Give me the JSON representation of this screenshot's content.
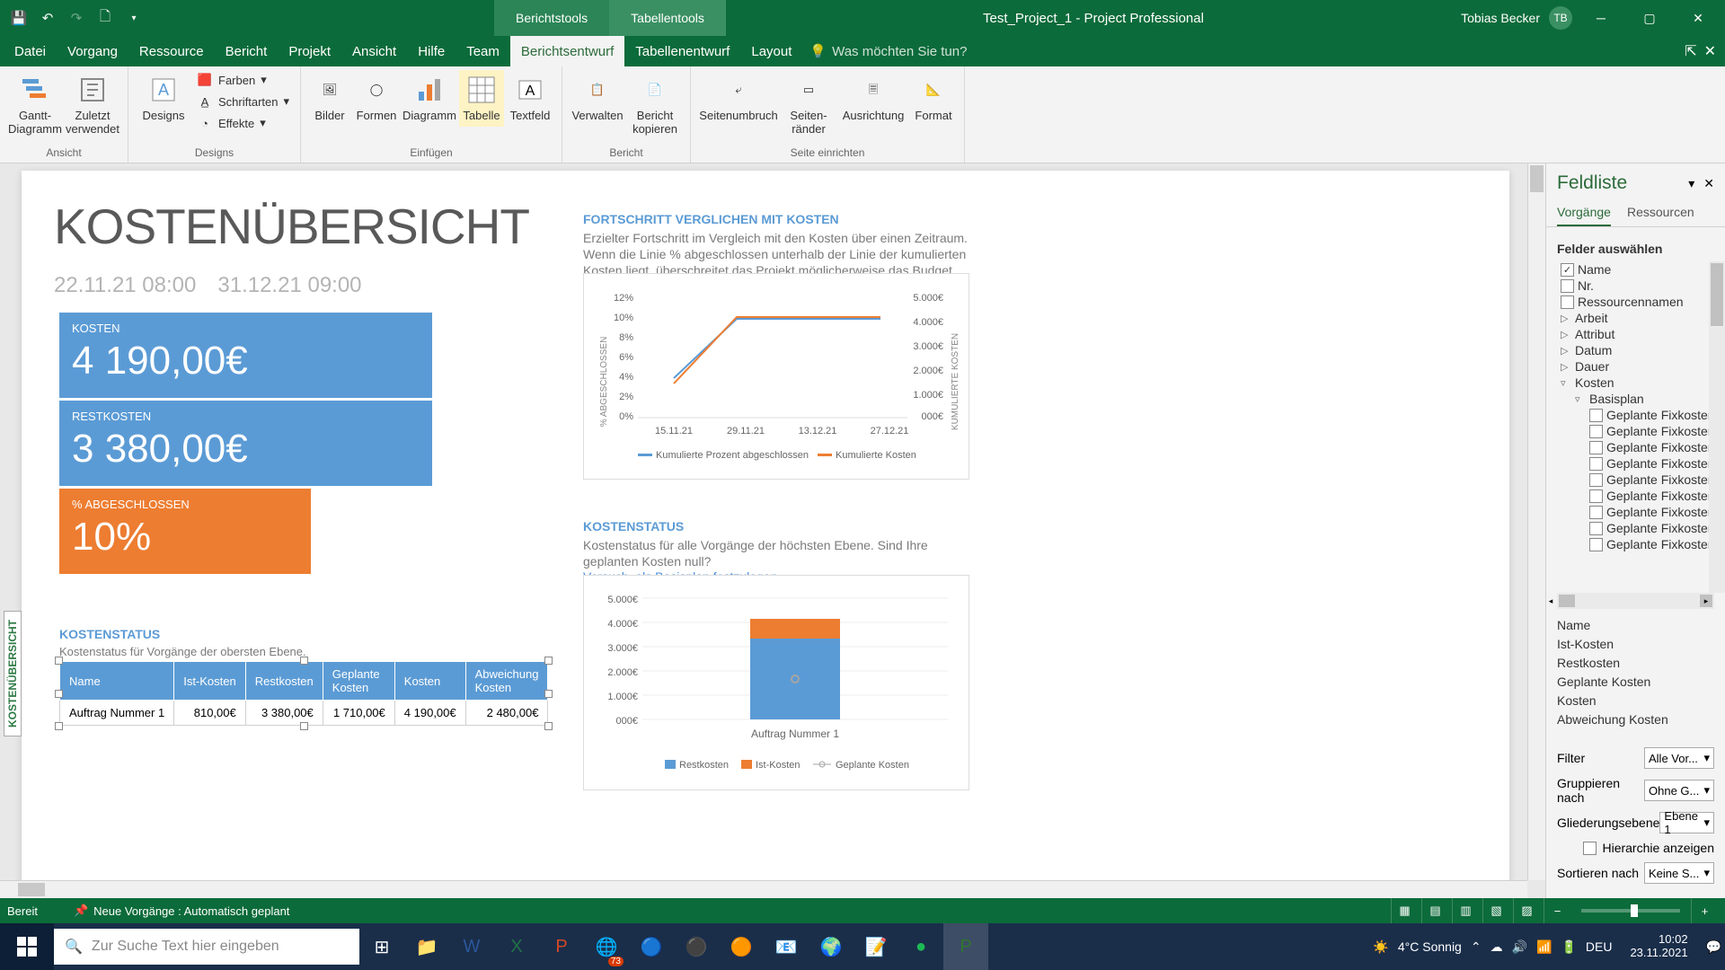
{
  "titlebar": {
    "doc": "Test_Project_1  -  Project Professional",
    "tool1": "Berichtstools",
    "tool2": "Tabellentools",
    "user": "Tobias Becker",
    "initials": "TB"
  },
  "menu": {
    "items": [
      "Datei",
      "Vorgang",
      "Ressource",
      "Bericht",
      "Projekt",
      "Ansicht",
      "Hilfe",
      "Team",
      "Berichtsentwurf",
      "Tabellenentwurf",
      "Layout"
    ],
    "tellme": "Was möchten Sie tun?"
  },
  "ribbon": {
    "ansicht": {
      "gantt": "Gantt-\nDiagramm",
      "zuletzt": "Zuletzt\nverwendet",
      "label": "Ansicht"
    },
    "designs": {
      "designs": "Designs",
      "farben": "Farben",
      "schriftarten": "Schriftarten",
      "effekte": "Effekte",
      "label": "Designs"
    },
    "einfuegen": {
      "bilder": "Bilder",
      "formen": "Formen",
      "diagramm": "Diagramm",
      "tabelle": "Tabelle",
      "textfeld": "Textfeld",
      "label": "Einfügen"
    },
    "bericht": {
      "verwalten": "Verwalten",
      "kopieren": "Bericht\nkopieren",
      "label": "Bericht"
    },
    "seite": {
      "umbruch": "Seitenumbruch",
      "raender": "Seiten-\nränder",
      "ausrichtung": "Ausrichtung",
      "format": "Format",
      "label": "Seite einrichten"
    }
  },
  "report": {
    "title": "KOSTENÜBERSICHT",
    "date1": "22.11.21 08:00",
    "date2": "31.12.21 09:00",
    "card_kosten_label": "KOSTEN",
    "card_kosten_value": "4 190,00€",
    "card_rest_label": "RESTKOSTEN",
    "card_rest_value": "3 380,00€",
    "card_pct_label": "% ABGESCHLOSSEN",
    "card_pct_value": "10%",
    "fortschritt_hdr": "FORTSCHRITT VERGLICHEN MIT KOSTEN",
    "fortschritt_desc": "Erzielter Fortschritt im Vergleich mit den Kosten über einen Zeitraum. Wenn die Linie % abgeschlossen unterhalb der Linie der kumulierten Kosten liegt, überschreitet das Projekt möglicherweise das Budget.",
    "kostenstatus_hdr": "KOSTENSTATUS",
    "kostenstatus_desc": "Kostenstatus für alle Vorgänge der höchsten Ebene. Sind Ihre geplanten Kosten null?",
    "kostenstatus_link": "Versuch, als Basisplan festzulegen",
    "ks2_hdr": "KOSTENSTATUS",
    "ks2_desc": "Kostenstatus für Vorgänge der obersten Ebene.",
    "table": {
      "headers": [
        "Name",
        "Ist-Kosten",
        "Restkosten",
        "Geplante Kosten",
        "Kosten",
        "Abweichung Kosten"
      ],
      "row": [
        "Auftrag Nummer 1",
        "810,00€",
        "3 380,00€",
        "1 710,00€",
        "4 190,00€",
        "2 480,00€"
      ]
    },
    "side_tab": "KOSTENÜBERSICHT"
  },
  "chart_data": [
    {
      "type": "line",
      "title": "",
      "xlabel": "",
      "ylabel_left": "% ABGESCHLOSSEN",
      "ylabel_right": "KUMULIERTE KOSTEN",
      "categories": [
        "15.11.21",
        "29.11.21",
        "13.12.21",
        "27.12.21"
      ],
      "y_left_ticks": [
        "0%",
        "2%",
        "4%",
        "6%",
        "8%",
        "10%",
        "12%"
      ],
      "y_right_ticks": [
        "000€",
        "1.000€",
        "2.000€",
        "3.000€",
        "4.000€",
        "5.000€"
      ],
      "series": [
        {
          "name": "Kumulierte Prozent abgeschlossen",
          "axis": "left",
          "values": [
            4,
            10,
            10,
            10
          ]
        },
        {
          "name": "Kumulierte Kosten",
          "axis": "right",
          "values": [
            1500,
            4190,
            4190,
            4190
          ]
        }
      ]
    },
    {
      "type": "bar",
      "title": "",
      "categories": [
        "Auftrag Nummer 1"
      ],
      "y_ticks": [
        "000€",
        "1.000€",
        "2.000€",
        "3.000€",
        "4.000€",
        "5.000€"
      ],
      "series": [
        {
          "name": "Restkosten",
          "values": [
            3380
          ]
        },
        {
          "name": "Ist-Kosten",
          "values": [
            810
          ]
        },
        {
          "name": "Geplante Kosten",
          "values": [
            1710
          ],
          "marker": true
        }
      ]
    }
  ],
  "fieldlist": {
    "title": "Feldliste",
    "tab1": "Vorgänge",
    "tab2": "Ressourcen",
    "select_label": "Felder auswählen",
    "tree": [
      {
        "l": 0,
        "chk": true,
        "t": "Name"
      },
      {
        "l": 0,
        "chk": false,
        "t": "Nr."
      },
      {
        "l": 0,
        "chk": false,
        "t": "Ressourcennamen"
      },
      {
        "l": 0,
        "exp": "▷",
        "t": "Arbeit"
      },
      {
        "l": 0,
        "exp": "▷",
        "t": "Attribut"
      },
      {
        "l": 0,
        "exp": "▷",
        "t": "Datum"
      },
      {
        "l": 0,
        "exp": "▷",
        "t": "Dauer"
      },
      {
        "l": 0,
        "exp": "▿",
        "t": "Kosten"
      },
      {
        "l": 1,
        "exp": "▿",
        "t": "Basisplan"
      },
      {
        "l": 2,
        "chk": false,
        "t": "Geplante Fixkosten"
      },
      {
        "l": 2,
        "chk": false,
        "t": "Geplante Fixkosten"
      },
      {
        "l": 2,
        "chk": false,
        "t": "Geplante Fixkosten"
      },
      {
        "l": 2,
        "chk": false,
        "t": "Geplante Fixkosten"
      },
      {
        "l": 2,
        "chk": false,
        "t": "Geplante Fixkosten"
      },
      {
        "l": 2,
        "chk": false,
        "t": "Geplante Fixkosten"
      },
      {
        "l": 2,
        "chk": false,
        "t": "Geplante Fixkosten"
      },
      {
        "l": 2,
        "chk": false,
        "t": "Geplante Fixkosten"
      },
      {
        "l": 2,
        "chk": false,
        "t": "Geplante Fixkosten"
      }
    ],
    "selected": [
      "Name",
      "Ist-Kosten",
      "Restkosten",
      "Geplante Kosten",
      "Kosten",
      "Abweichung Kosten"
    ],
    "filter_label": "Filter",
    "filter_val": "Alle Vor...",
    "group_label": "Gruppieren nach",
    "group_val": "Ohne G...",
    "glied_label": "Gliederungsebene",
    "glied_val": "Ebene 1",
    "hier_label": "Hierarchie anzeigen",
    "sort_label": "Sortieren nach",
    "sort_val": "Keine S..."
  },
  "statusbar": {
    "ready": "Bereit",
    "sched": "Neue Vorgänge : Automatisch geplant"
  },
  "taskbar": {
    "search": "Zur Suche Text hier eingeben",
    "weather": "4°C Sonnig",
    "time": "10:02",
    "date": "23.11.2021",
    "lang": "DEU",
    "edge_badge": "73"
  }
}
